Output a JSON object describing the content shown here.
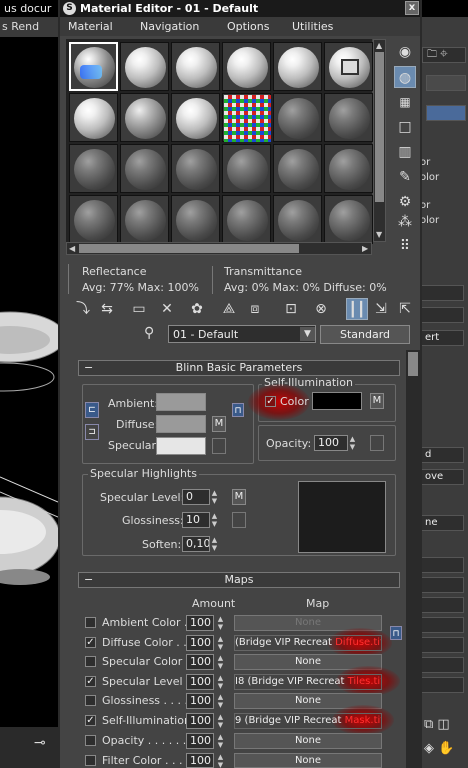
{
  "background_app": {
    "title": "us docur",
    "menu": "s  Rend"
  },
  "right_panel": {
    "labels": [
      "or",
      "olor",
      "or",
      "olor"
    ],
    "buttons": [
      "d",
      "ove",
      "e",
      "ert",
      "ne"
    ]
  },
  "window": {
    "title": "Material Editor - 01 - Default",
    "close": "x"
  },
  "menu": [
    "Material",
    "Navigation",
    "Options",
    "Utilities"
  ],
  "reflectance": {
    "title": "Reflectance",
    "values": "Avg:   77% Max: 100%"
  },
  "transmittance": {
    "title": "Transmittance",
    "values": "Avg:     0% Max:     0%  Diffuse:     0%"
  },
  "material": {
    "name": "01 - Default",
    "type": "Standard"
  },
  "blinn": {
    "header": "Blinn Basic Parameters",
    "self_illumination_title": "Self-Illumination",
    "color_label": "Color",
    "ambient_label": "Ambient:",
    "diffuse_label": "Diffuse:",
    "specular_label": "Specular:",
    "opacity_label": "Opacity:",
    "opacity_value": "100",
    "m_label": "M",
    "colors": {
      "ambient": "#9a9a9a",
      "diffuse": "#9a9a9a",
      "specular": "#e6e6e6",
      "self_illum": "#000000"
    }
  },
  "specular_highlights": {
    "title": "Specular Highlights",
    "specular_level_label": "Specular Level:",
    "specular_level_value": "0",
    "glossiness_label": "Glossiness:",
    "glossiness_value": "10",
    "soften_label": "Soften:",
    "soften_value": "0,100"
  },
  "maps": {
    "header": "Maps",
    "amount_header": "Amount",
    "map_header": "Map",
    "rows": [
      {
        "label": "Ambient Color . . .",
        "checked": false,
        "amount": "100",
        "map": "None",
        "dim": true
      },
      {
        "label": "Diffuse Color . . . .",
        "checked": true,
        "amount": "100",
        "map_prefix": "(Bridge VIP Recreat ",
        "map_suffix": "Diffuse.tif)"
      },
      {
        "label": "Specular Color . . .",
        "checked": false,
        "amount": "100",
        "map": "None"
      },
      {
        "label": "Specular Level . .",
        "checked": true,
        "amount": "100",
        "map_prefix": "I8 (Bridge VIP Recreat ",
        "map_suffix": "Tiles.tif)"
      },
      {
        "label": "Glossiness . . . . . .",
        "checked": false,
        "amount": "100",
        "map": "None"
      },
      {
        "label": "Self-Illumination .",
        "checked": true,
        "amount": "100",
        "map_prefix": "9 (Bridge VIP Recreat ",
        "map_suffix": "Mask.tif)"
      },
      {
        "label": "Opacity . . . . . . . .",
        "checked": false,
        "amount": "100",
        "map": "None"
      },
      {
        "label": "Filter Color . . . . .",
        "checked": false,
        "amount": "100",
        "map": "None"
      }
    ]
  }
}
